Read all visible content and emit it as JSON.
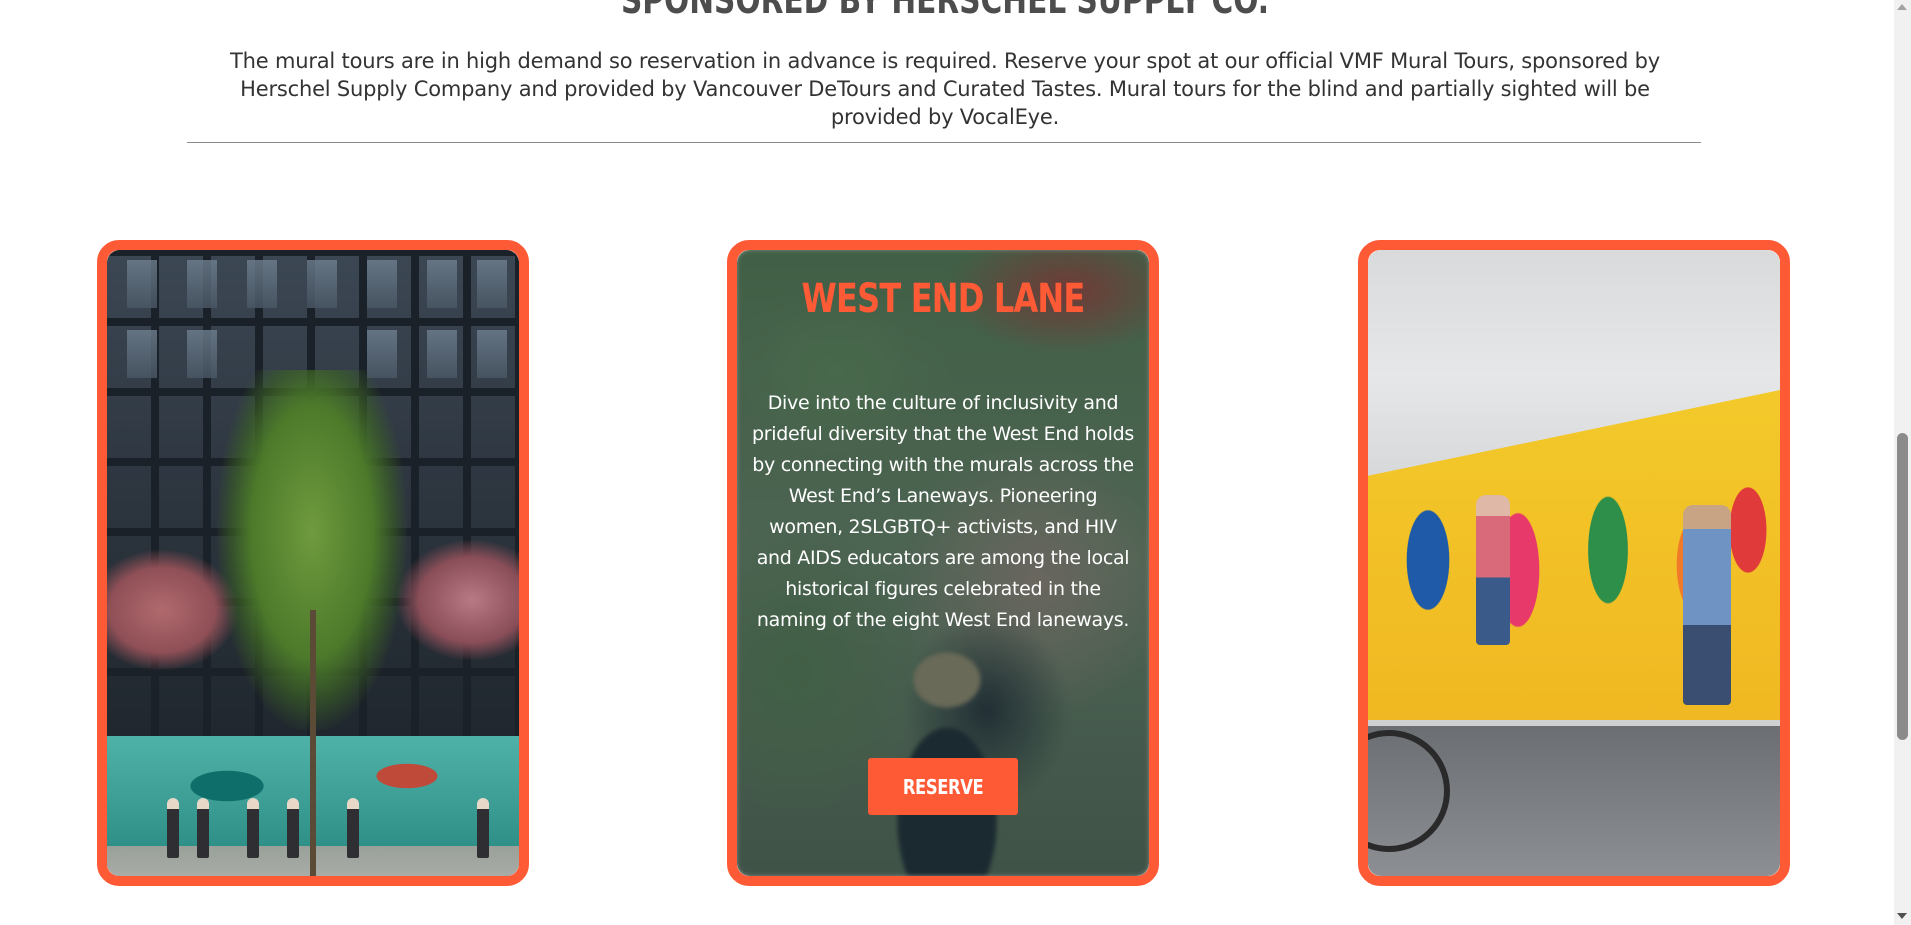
{
  "section": {
    "heading": "SPONSORED BY HERSCHEL SUPPLY CO.",
    "intro": "The mural tours are in high demand so reservation in advance is required. Reserve your spot at our official VMF Mural Tours, sponsored by Herschel Supply Company and provided by Vancouver DeTours and Curated Tastes. Mural tours for the blind and partially sighted will be provided by VocalEye."
  },
  "cards": [
    {
      "image": "mural-painting-street-scene-with-tree"
    },
    {
      "title": "WEST END LANE",
      "body": "Dive into the culture of inclusivity and prideful diversity that the West End holds by connecting with the murals across the West End’s Laneways. Pioneering women, 2SLGBTQ+ activists, and HIV and AIDS educators are among the local historical figures celebrated in the naming of the eight West End laneways.",
      "button_label": "RESERVE"
    },
    {
      "image": "artists-painting-colorful-mural"
    }
  ],
  "colors": {
    "accent": "#ff5a36",
    "heading": "#4d4d4d",
    "text": "#333333"
  }
}
